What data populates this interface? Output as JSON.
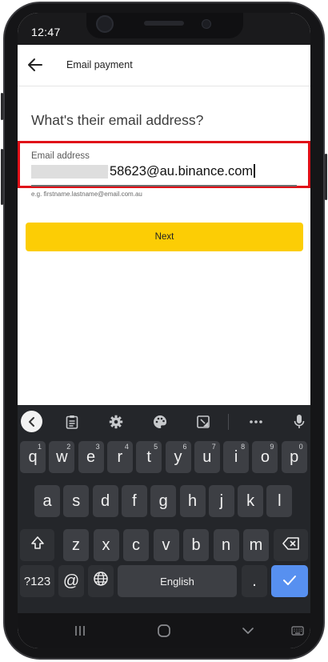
{
  "status_bar": {
    "time": "12:47"
  },
  "app_bar": {
    "title": "Email payment",
    "back_icon": "arrow-left-icon"
  },
  "form": {
    "question": "What's their email address?",
    "email_label": "Email address",
    "email_value": "58623@au.binance.com",
    "email_hint": "e.g. firstname.lastname@email.com.au",
    "highlight_color": "#e01018"
  },
  "next_button": {
    "label": "Next",
    "color": "#fccd05"
  },
  "keyboard": {
    "toolbar_icons": [
      "chevron-left-icon",
      "clipboard-icon",
      "gear-icon",
      "palette-icon",
      "screenshot-icon",
      "more-icon",
      "microphone-icon"
    ],
    "row1": [
      {
        "label": "q",
        "sup": "1"
      },
      {
        "label": "w",
        "sup": "2"
      },
      {
        "label": "e",
        "sup": "3"
      },
      {
        "label": "r",
        "sup": "4"
      },
      {
        "label": "t",
        "sup": "5"
      },
      {
        "label": "y",
        "sup": "6"
      },
      {
        "label": "u",
        "sup": "7"
      },
      {
        "label": "i",
        "sup": "8"
      },
      {
        "label": "o",
        "sup": "9"
      },
      {
        "label": "p",
        "sup": "0"
      }
    ],
    "row2": [
      "a",
      "s",
      "d",
      "f",
      "g",
      "h",
      "j",
      "k",
      "l"
    ],
    "row3": [
      "z",
      "x",
      "c",
      "v",
      "b",
      "n",
      "m"
    ],
    "row4": {
      "symbols": "?123",
      "at": "@",
      "space": "English",
      "period": "."
    },
    "shift_icon": "shift-icon",
    "backspace_icon": "backspace-icon",
    "globe_icon": "globe-icon",
    "enter_icon": "checkmark-icon",
    "enter_color": "#5790f0"
  },
  "nav_bar": {
    "icons": [
      "recent-apps-icon",
      "home-icon",
      "back-chevron-icon",
      "keyboard-icon"
    ]
  }
}
